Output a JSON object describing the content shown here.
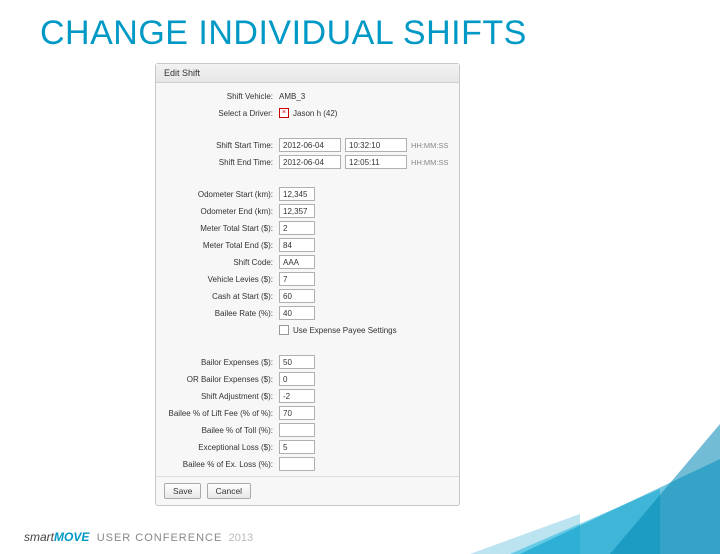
{
  "title": "CHANGE INDIVIDUAL SHIFTS",
  "panel": {
    "header": "Edit Shift"
  },
  "fields": {
    "vehicle_label": "Shift Vehicle:",
    "vehicle_value": "AMB_3",
    "driver_label": "Select a Driver:",
    "driver_value": "Jason h (42)",
    "start_label": "Shift Start Time:",
    "start_date": "2012-06-04",
    "start_time": "10:32:10",
    "start_hint": "HH:MM:SS",
    "end_label": "Shift End Time:",
    "end_date": "2012-06-04",
    "end_time": "12:05:11",
    "end_hint": "HH:MM:SS",
    "odo_start_label": "Odometer Start (km):",
    "odo_start": "12,345",
    "odo_end_label": "Odometer End (km):",
    "odo_end": "12,357",
    "meter_start_label": "Meter Total Start ($):",
    "meter_start": "2",
    "meter_end_label": "Meter Total End ($):",
    "meter_end": "84",
    "shift_code_label": "Shift Code:",
    "shift_code": "AAA",
    "levies_label": "Vehicle Levies ($):",
    "levies": "7",
    "cash_start_label": "Cash at Start ($):",
    "cash_start": "60",
    "rate_label": "Bailee Rate (%):",
    "rate": "40",
    "use_settings_label": "Use Expense Payee Settings",
    "bailor_exp_label": "Bailor Expenses ($):",
    "bailor_exp": "50",
    "or_bailor_exp_label": "OR Bailor Expenses ($):",
    "or_bailor_exp": "0",
    "adj_label": "Shift Adjustment ($):",
    "adj": "-2",
    "lift_pct_label": "Bailee % of Lift Fee (% of %):",
    "lift_pct": "70",
    "toll_pct_label": "Bailee % of Toll (%):",
    "toll_pct": "",
    "excep_loss_label": "Exceptional Loss ($):",
    "excep_loss": "5",
    "excep_pct_label": "Bailee % of Ex. Loss (%):",
    "excep_pct": ""
  },
  "buttons": {
    "save": "Save",
    "cancel": "Cancel"
  },
  "footer": {
    "brand1": "smart",
    "brand2": "MOVE",
    "conf": "USER CONFERENCE",
    "year": "2013"
  }
}
